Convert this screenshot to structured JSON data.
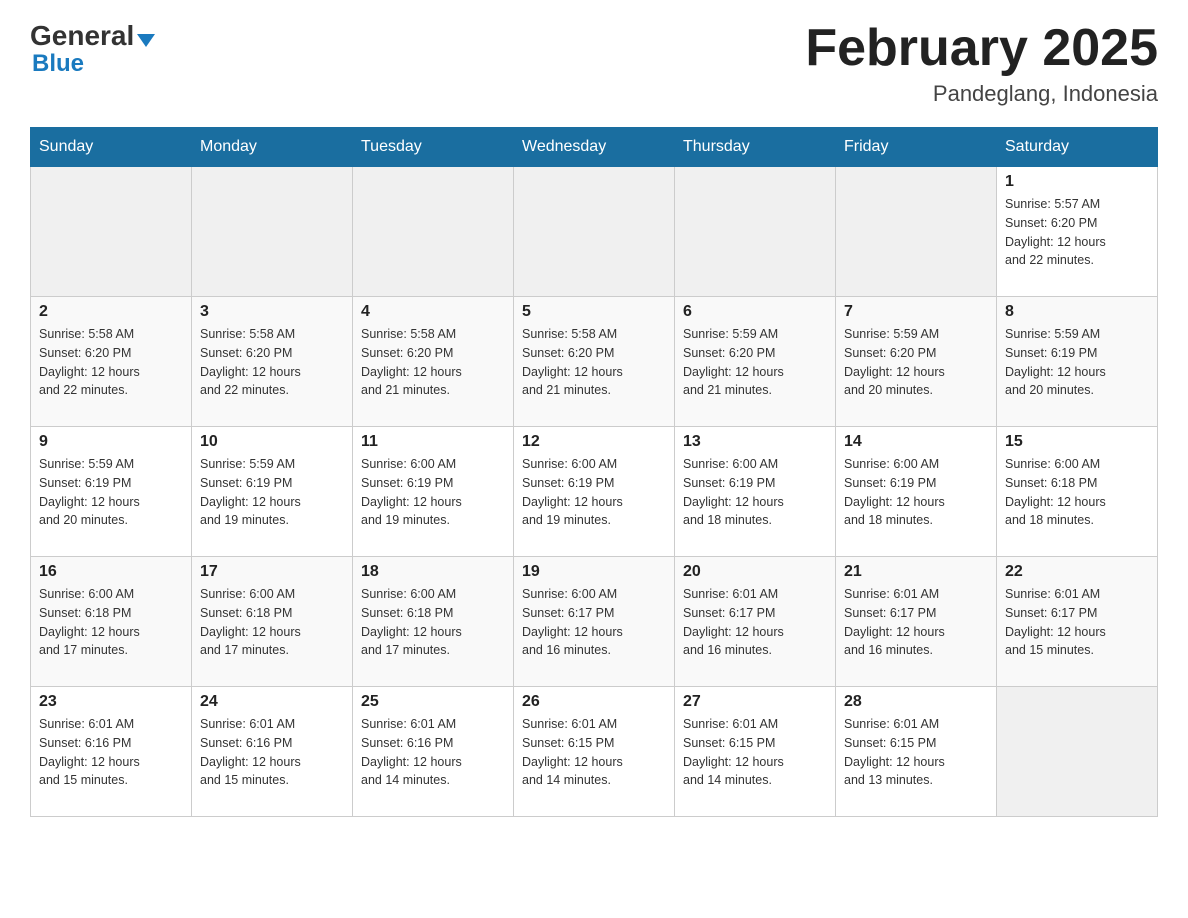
{
  "header": {
    "logo_general": "General",
    "logo_blue": "Blue",
    "month_title": "February 2025",
    "location": "Pandeglang, Indonesia"
  },
  "weekdays": [
    "Sunday",
    "Monday",
    "Tuesday",
    "Wednesday",
    "Thursday",
    "Friday",
    "Saturday"
  ],
  "weeks": [
    [
      {
        "day": "",
        "info": ""
      },
      {
        "day": "",
        "info": ""
      },
      {
        "day": "",
        "info": ""
      },
      {
        "day": "",
        "info": ""
      },
      {
        "day": "",
        "info": ""
      },
      {
        "day": "",
        "info": ""
      },
      {
        "day": "1",
        "info": "Sunrise: 5:57 AM\nSunset: 6:20 PM\nDaylight: 12 hours\nand 22 minutes."
      }
    ],
    [
      {
        "day": "2",
        "info": "Sunrise: 5:58 AM\nSunset: 6:20 PM\nDaylight: 12 hours\nand 22 minutes."
      },
      {
        "day": "3",
        "info": "Sunrise: 5:58 AM\nSunset: 6:20 PM\nDaylight: 12 hours\nand 22 minutes."
      },
      {
        "day": "4",
        "info": "Sunrise: 5:58 AM\nSunset: 6:20 PM\nDaylight: 12 hours\nand 21 minutes."
      },
      {
        "day": "5",
        "info": "Sunrise: 5:58 AM\nSunset: 6:20 PM\nDaylight: 12 hours\nand 21 minutes."
      },
      {
        "day": "6",
        "info": "Sunrise: 5:59 AM\nSunset: 6:20 PM\nDaylight: 12 hours\nand 21 minutes."
      },
      {
        "day": "7",
        "info": "Sunrise: 5:59 AM\nSunset: 6:20 PM\nDaylight: 12 hours\nand 20 minutes."
      },
      {
        "day": "8",
        "info": "Sunrise: 5:59 AM\nSunset: 6:19 PM\nDaylight: 12 hours\nand 20 minutes."
      }
    ],
    [
      {
        "day": "9",
        "info": "Sunrise: 5:59 AM\nSunset: 6:19 PM\nDaylight: 12 hours\nand 20 minutes."
      },
      {
        "day": "10",
        "info": "Sunrise: 5:59 AM\nSunset: 6:19 PM\nDaylight: 12 hours\nand 19 minutes."
      },
      {
        "day": "11",
        "info": "Sunrise: 6:00 AM\nSunset: 6:19 PM\nDaylight: 12 hours\nand 19 minutes."
      },
      {
        "day": "12",
        "info": "Sunrise: 6:00 AM\nSunset: 6:19 PM\nDaylight: 12 hours\nand 19 minutes."
      },
      {
        "day": "13",
        "info": "Sunrise: 6:00 AM\nSunset: 6:19 PM\nDaylight: 12 hours\nand 18 minutes."
      },
      {
        "day": "14",
        "info": "Sunrise: 6:00 AM\nSunset: 6:19 PM\nDaylight: 12 hours\nand 18 minutes."
      },
      {
        "day": "15",
        "info": "Sunrise: 6:00 AM\nSunset: 6:18 PM\nDaylight: 12 hours\nand 18 minutes."
      }
    ],
    [
      {
        "day": "16",
        "info": "Sunrise: 6:00 AM\nSunset: 6:18 PM\nDaylight: 12 hours\nand 17 minutes."
      },
      {
        "day": "17",
        "info": "Sunrise: 6:00 AM\nSunset: 6:18 PM\nDaylight: 12 hours\nand 17 minutes."
      },
      {
        "day": "18",
        "info": "Sunrise: 6:00 AM\nSunset: 6:18 PM\nDaylight: 12 hours\nand 17 minutes."
      },
      {
        "day": "19",
        "info": "Sunrise: 6:00 AM\nSunset: 6:17 PM\nDaylight: 12 hours\nand 16 minutes."
      },
      {
        "day": "20",
        "info": "Sunrise: 6:01 AM\nSunset: 6:17 PM\nDaylight: 12 hours\nand 16 minutes."
      },
      {
        "day": "21",
        "info": "Sunrise: 6:01 AM\nSunset: 6:17 PM\nDaylight: 12 hours\nand 16 minutes."
      },
      {
        "day": "22",
        "info": "Sunrise: 6:01 AM\nSunset: 6:17 PM\nDaylight: 12 hours\nand 15 minutes."
      }
    ],
    [
      {
        "day": "23",
        "info": "Sunrise: 6:01 AM\nSunset: 6:16 PM\nDaylight: 12 hours\nand 15 minutes."
      },
      {
        "day": "24",
        "info": "Sunrise: 6:01 AM\nSunset: 6:16 PM\nDaylight: 12 hours\nand 15 minutes."
      },
      {
        "day": "25",
        "info": "Sunrise: 6:01 AM\nSunset: 6:16 PM\nDaylight: 12 hours\nand 14 minutes."
      },
      {
        "day": "26",
        "info": "Sunrise: 6:01 AM\nSunset: 6:15 PM\nDaylight: 12 hours\nand 14 minutes."
      },
      {
        "day": "27",
        "info": "Sunrise: 6:01 AM\nSunset: 6:15 PM\nDaylight: 12 hours\nand 14 minutes."
      },
      {
        "day": "28",
        "info": "Sunrise: 6:01 AM\nSunset: 6:15 PM\nDaylight: 12 hours\nand 13 minutes."
      },
      {
        "day": "",
        "info": ""
      }
    ]
  ]
}
